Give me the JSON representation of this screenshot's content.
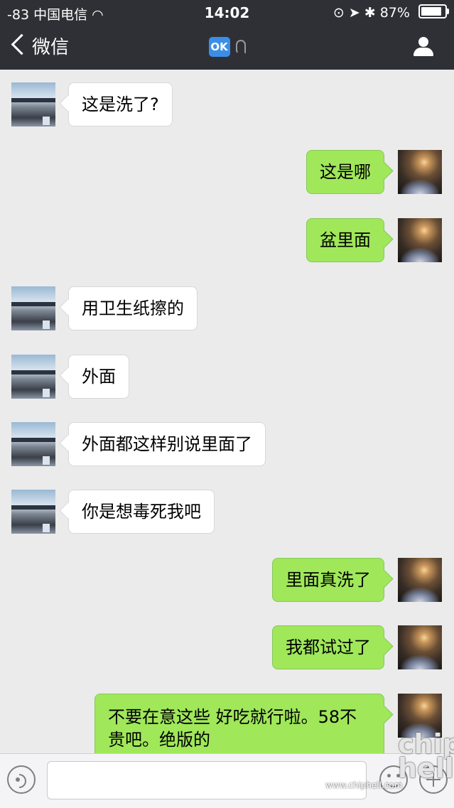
{
  "status": {
    "signal": "-83",
    "carrier": "中国电信",
    "time": "14:02",
    "battery": "87%"
  },
  "nav": {
    "back_label": "微信",
    "badge": "OK"
  },
  "messages": [
    {
      "side": "peer",
      "text": "这是洗了?"
    },
    {
      "side": "me",
      "text": "这是哪"
    },
    {
      "side": "me",
      "text": "盆里面"
    },
    {
      "side": "peer",
      "text": "用卫生纸擦的"
    },
    {
      "side": "peer",
      "text": "外面"
    },
    {
      "side": "peer",
      "text": "外面都这样别说里面了"
    },
    {
      "side": "peer",
      "text": "你是想毒死我吧"
    },
    {
      "side": "me",
      "text": "里面真洗了"
    },
    {
      "side": "me",
      "text": "我都试过了"
    },
    {
      "side": "me",
      "text": "不要在意这些 好吃就行啦。58不贵吧。绝版的"
    }
  ],
  "watermark": {
    "text": "chip hell",
    "url": "www.chiphell.com"
  }
}
